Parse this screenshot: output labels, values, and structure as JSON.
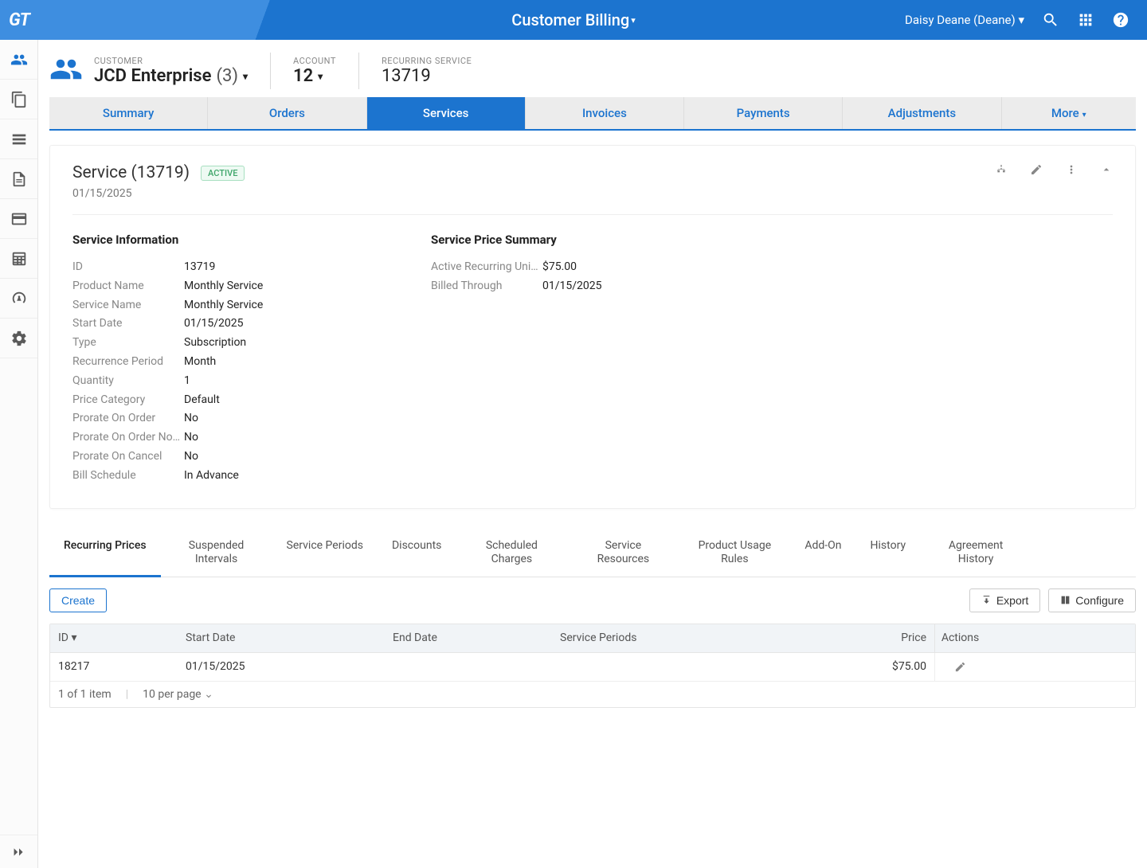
{
  "app": {
    "logo": "GT",
    "module": "Customer Billing",
    "user": "Daisy Deane (Deane)"
  },
  "context": {
    "customer_label": "CUSTOMER",
    "customer_name": "JCD Enterprise",
    "customer_count": "(3)",
    "account_label": "ACCOUNT",
    "account_value": "12",
    "service_label": "RECURRING SERVICE",
    "service_value": "13719"
  },
  "tabs": {
    "summary": "Summary",
    "orders": "Orders",
    "services": "Services",
    "invoices": "Invoices",
    "payments": "Payments",
    "adjustments": "Adjustments",
    "more": "More"
  },
  "card": {
    "title": "Service (13719)",
    "status": "ACTIVE",
    "date": "01/15/2025",
    "info_heading": "Service Information",
    "price_heading": "Service Price Summary",
    "info": {
      "id_k": "ID",
      "id_v": "13719",
      "pn_k": "Product Name",
      "pn_v": "Monthly Service",
      "sn_k": "Service Name",
      "sn_v": "Monthly Service",
      "sd_k": "Start Date",
      "sd_v": "01/15/2025",
      "type_k": "Type",
      "type_v": "Subscription",
      "rp_k": "Recurrence Period",
      "rp_v": "Month",
      "qty_k": "Quantity",
      "qty_v": "1",
      "pc_k": "Price Category",
      "pc_v": "Default",
      "poo_k": "Prorate On Order",
      "poo_v": "No",
      "poon_k": "Prorate On Order No…",
      "poon_v": "No",
      "poc_k": "Prorate On Cancel",
      "poc_v": "No",
      "bs_k": "Bill Schedule",
      "bs_v": "In Advance"
    },
    "price": {
      "aru_k": "Active Recurring Uni…",
      "aru_v": "$75.00",
      "bt_k": "Billed Through",
      "bt_v": "01/15/2025"
    }
  },
  "subtabs": {
    "rp": "Recurring Prices",
    "si": "Suspended Intervals",
    "sp": "Service Periods",
    "disc": "Discounts",
    "sc": "Scheduled Charges",
    "sr": "Service Resources",
    "pur": "Product Usage Rules",
    "addon": "Add-On",
    "hist": "History",
    "ah": "Agreement History"
  },
  "toolbar": {
    "create": "Create",
    "export": "Export",
    "configure": "Configure"
  },
  "grid": {
    "headers": {
      "id": "ID",
      "start": "Start Date",
      "end": "End Date",
      "periods": "Service Periods",
      "price": "Price",
      "actions": "Actions"
    },
    "row": {
      "id": "18217",
      "start": "01/15/2025",
      "end": "",
      "periods": "",
      "price": "$75.00"
    },
    "footer": {
      "count": "1 of 1 item",
      "per_page": "10 per page"
    }
  }
}
